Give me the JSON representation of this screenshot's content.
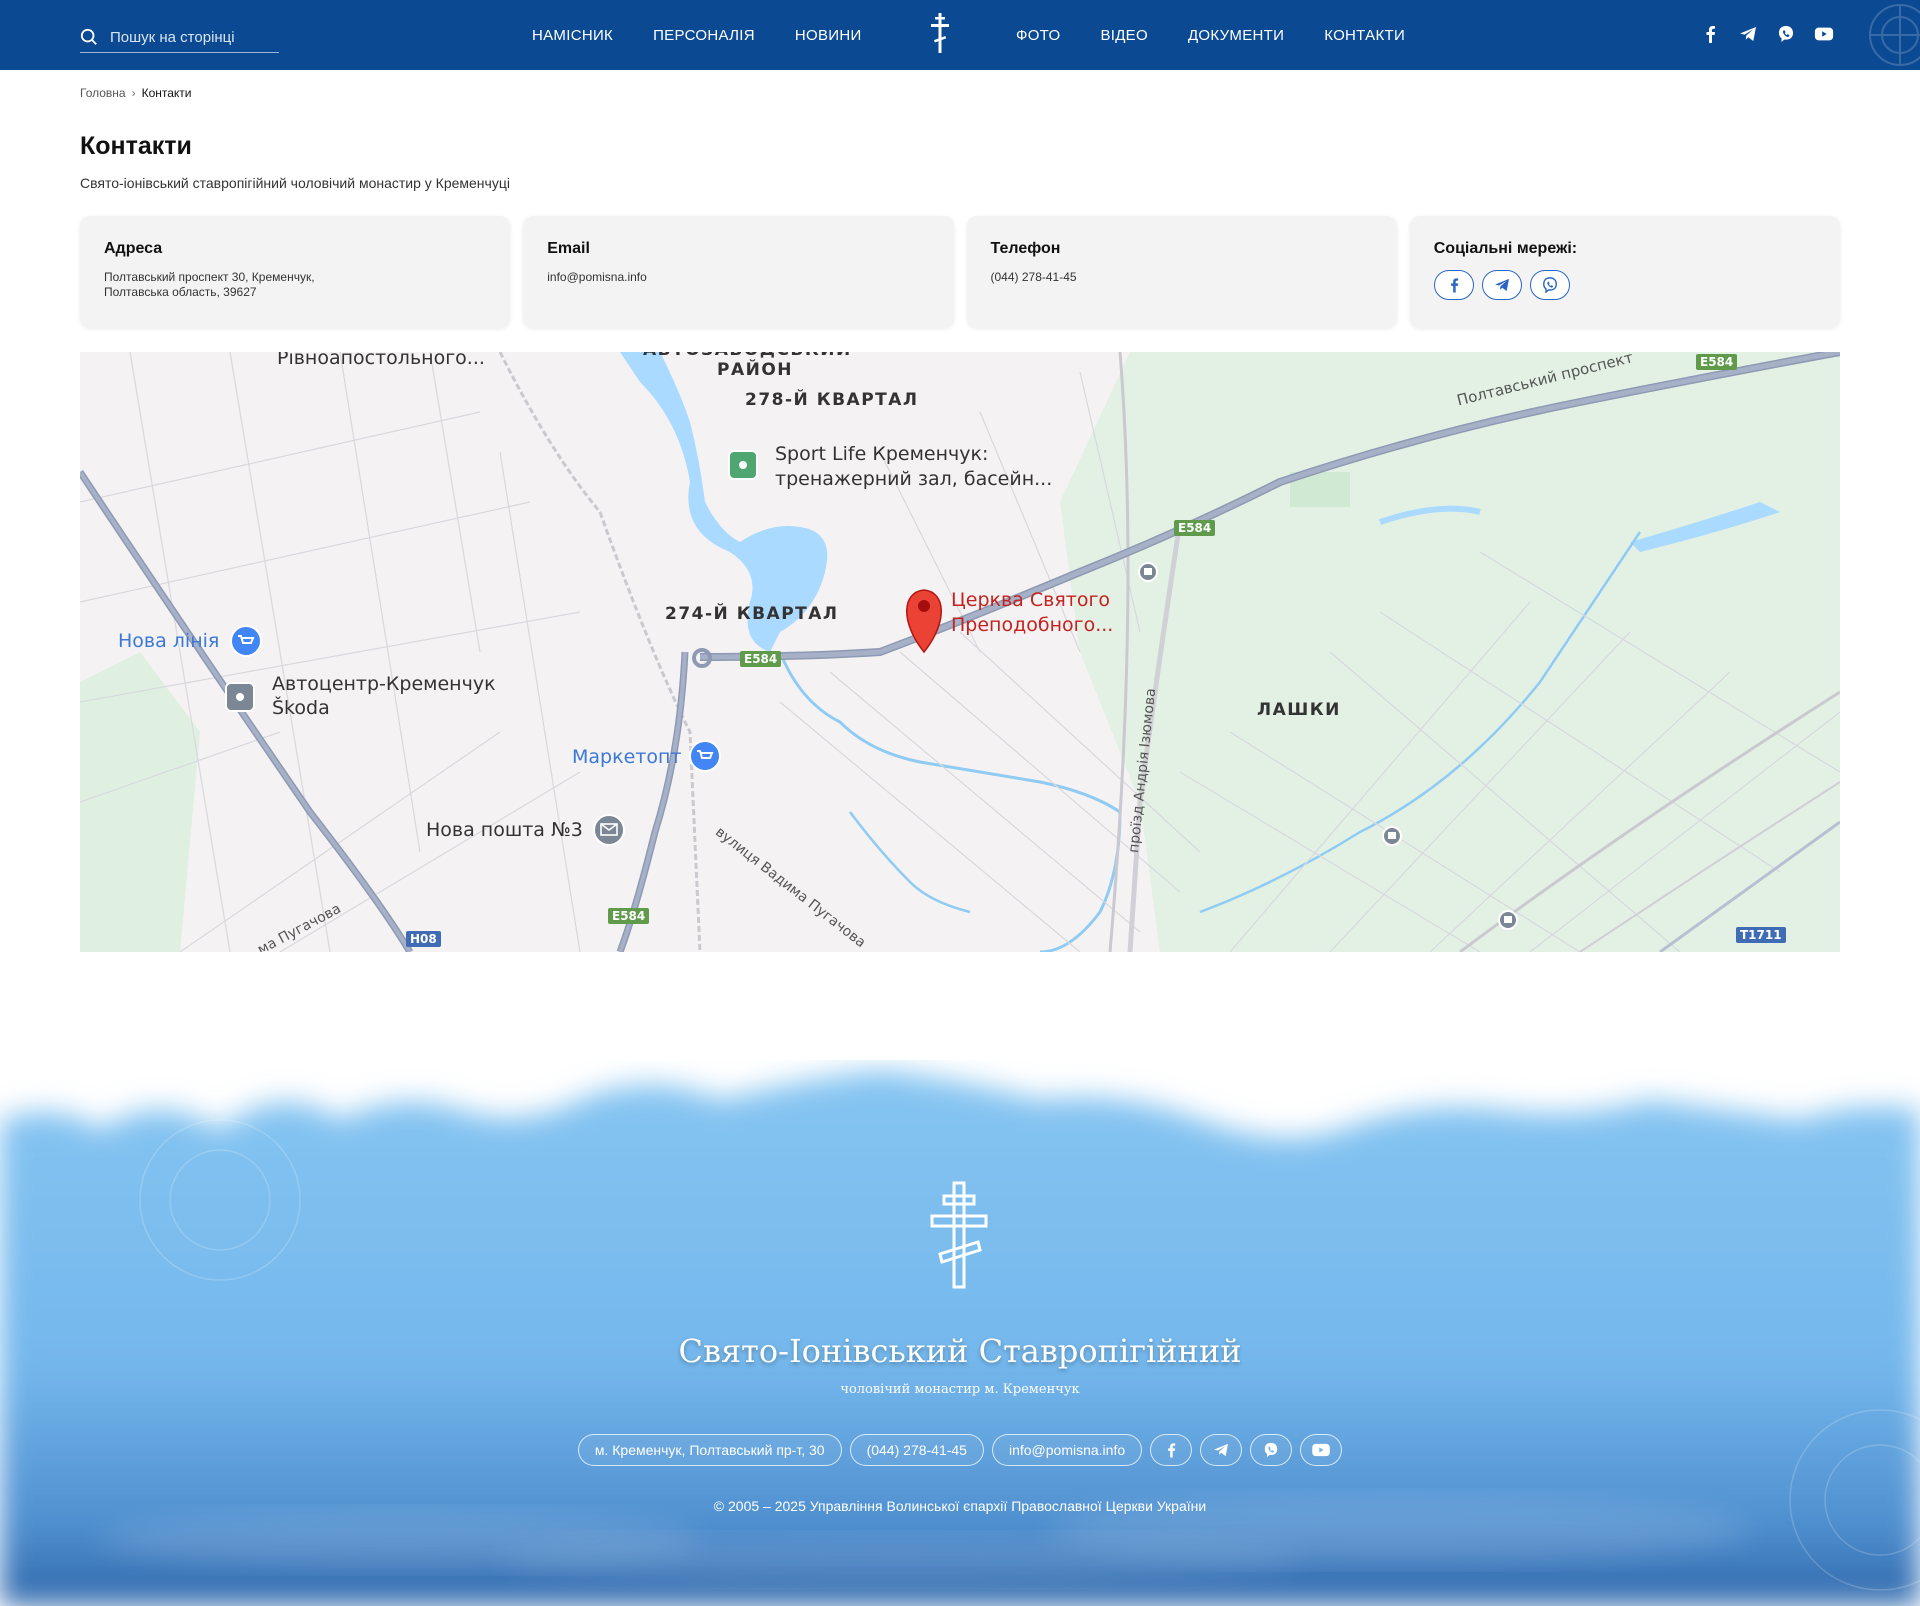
{
  "header": {
    "search_placeholder": "Пошук на сторінці",
    "nav_left": [
      "НАМІСНИК",
      "ПЕРСОНАЛІЯ",
      "НОВИНИ"
    ],
    "nav_right": [
      "ФОТО",
      "ВІДЕО",
      "ДОКУМЕНТИ",
      "КОНТАКТИ"
    ],
    "socials": [
      "facebook-icon",
      "telegram-icon",
      "viber-icon",
      "youtube-icon"
    ]
  },
  "breadcrumb": {
    "home": "Головна",
    "current": "Контакти"
  },
  "page": {
    "title": "Контакти",
    "subtitle": "Свято-іонівський ставропігійний чоловічий монастир у Кременчуці"
  },
  "cards": {
    "address": {
      "title": "Адреса",
      "value": "Полтавський проспект 30, Кременчук,\nПолтавська область, 39627"
    },
    "email": {
      "title": "Email",
      "value": "info@pomisna.info"
    },
    "phone": {
      "title": "Телефон",
      "value": "(044) 278-41-45"
    },
    "social": {
      "title": "Соціальні мережі:"
    }
  },
  "map": {
    "labels": {
      "district_top": "АВТОЗАВОДСЬКИЙ",
      "raion": "РАЙОН",
      "q278": "278-Й КВАРТАЛ",
      "q274": "274-Й КВАРТАЛ",
      "lashky": "ЛАШКИ",
      "rivno": "Рівноапостольного...",
      "sport1": "Sport Life Кременчук:",
      "sport2": "тренажерний зал, басейн...",
      "church1": "Церква Святого",
      "church2": "Преподобного...",
      "nova_liniia": "Нова лінія",
      "autocentre1": "Автоцентр-Кременчук",
      "autocentre2": "Škoda",
      "marketopt": "Маркетопт",
      "nova_poshta": "Нова пошта №3",
      "poltavskyi": "Полтавський проспект",
      "izyumova": "проїзд Андрія Ізюмова",
      "puhachova": "вулиця Вадима Пугачова",
      "puhachova2": "ма Пугачова"
    },
    "shields": {
      "e584_a": "E584",
      "e584_b": "E584",
      "e584_c": "E584",
      "e584_d": "E584",
      "h08": "H08",
      "t1711": "T1711"
    }
  },
  "footer": {
    "title": "Свято-Іонівський Ставропігійний",
    "subtitle": "чоловічий монастир м. Кременчук",
    "address": "м. Кременчук, Полтавський пр-т, 30",
    "phone": "(044) 278-41-45",
    "email": "info@pomisna.info",
    "copyright": "© 2005 – 2025 Управління Волинської єпархії Православної Церкви України"
  },
  "colors": {
    "header_bg": "#0b4a93",
    "accent": "#2a66c2",
    "footer_sky": "#7bbcef"
  }
}
